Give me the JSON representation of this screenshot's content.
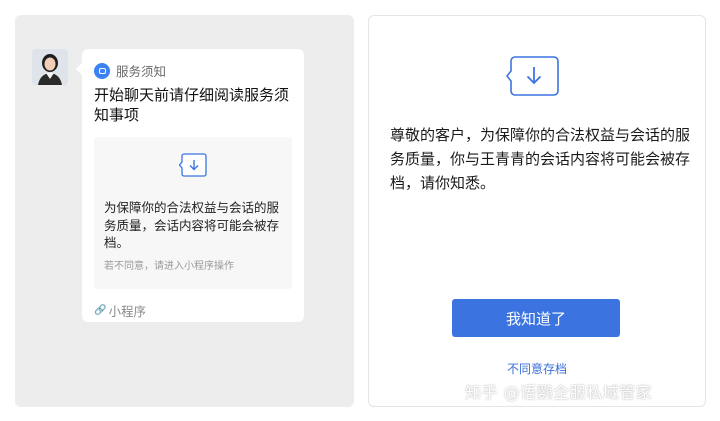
{
  "left_panel": {
    "service_label": "服务须知",
    "bubble_title": "开始聊天前请仔细阅读服务须知事项",
    "card_text": "为保障你的合法权益与会话的服务质量，会话内容将可能会被存档。",
    "card_sub_text": "若不同意，请进入小程序操作",
    "miniprogram_label": "小程序",
    "link_icon": "🔗"
  },
  "right_panel": {
    "notice_text": "尊敬的客户，为保障你的合法权益与会话的服务质量，你与王青青的会话内容将可能会被存档，请你知悉。",
    "ok_button_label": "我知道了",
    "disagree_label": "不同意存档"
  },
  "watermark": "知乎 @语鹦企服私域管家",
  "colors": {
    "accent": "#3b74e0",
    "link": "#3b6fd8",
    "panel_bg": "#ededed"
  }
}
